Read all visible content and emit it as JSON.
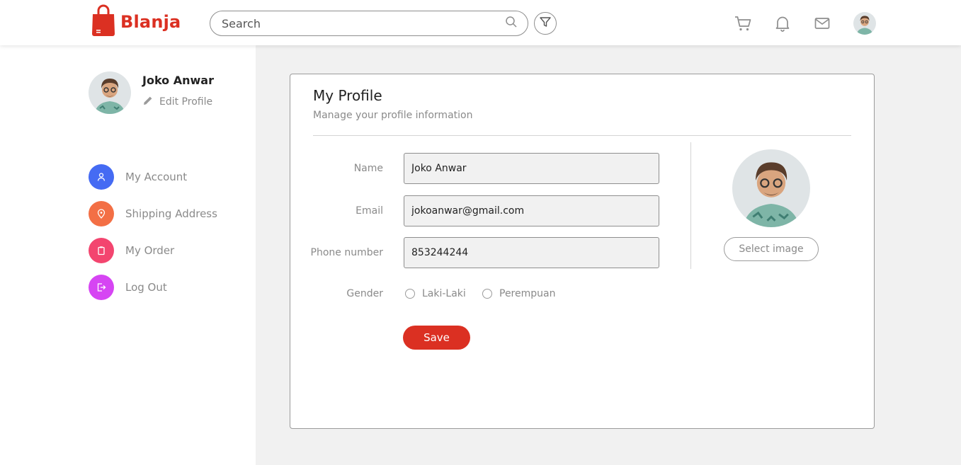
{
  "header": {
    "logo_text": "Blanja",
    "search_placeholder": "Search",
    "icons": [
      "shopping-bag-icon",
      "search-icon",
      "filter-icon",
      "cart-icon",
      "bell-icon",
      "mail-icon"
    ],
    "accent_color": "#db3022"
  },
  "sidebar": {
    "user_name": "Joko Anwar",
    "edit_profile": "Edit Profile",
    "items": [
      {
        "label": "My Account",
        "color": "#456bf3",
        "icon": "user-icon"
      },
      {
        "label": "Shipping Address",
        "color": "#f36f45",
        "icon": "map-pin-icon"
      },
      {
        "label": "My Order",
        "color": "#f3456f",
        "icon": "clipboard-icon"
      },
      {
        "label": "Log Out",
        "color": "#d645f3",
        "icon": "logout-icon"
      }
    ]
  },
  "profile": {
    "title": "My Profile",
    "subtitle": "Manage your profile information",
    "fields": {
      "name_label": "Name",
      "name_value": "Joko Anwar",
      "email_label": "Email",
      "email_value": "jokoanwar@gmail.com",
      "phone_label": "Phone number",
      "phone_value": "853244244"
    },
    "gender_label": "Gender",
    "gender_options": [
      "Laki-Laki",
      "Perempuan"
    ],
    "save_label": "Save",
    "select_image_label": "Select image"
  }
}
